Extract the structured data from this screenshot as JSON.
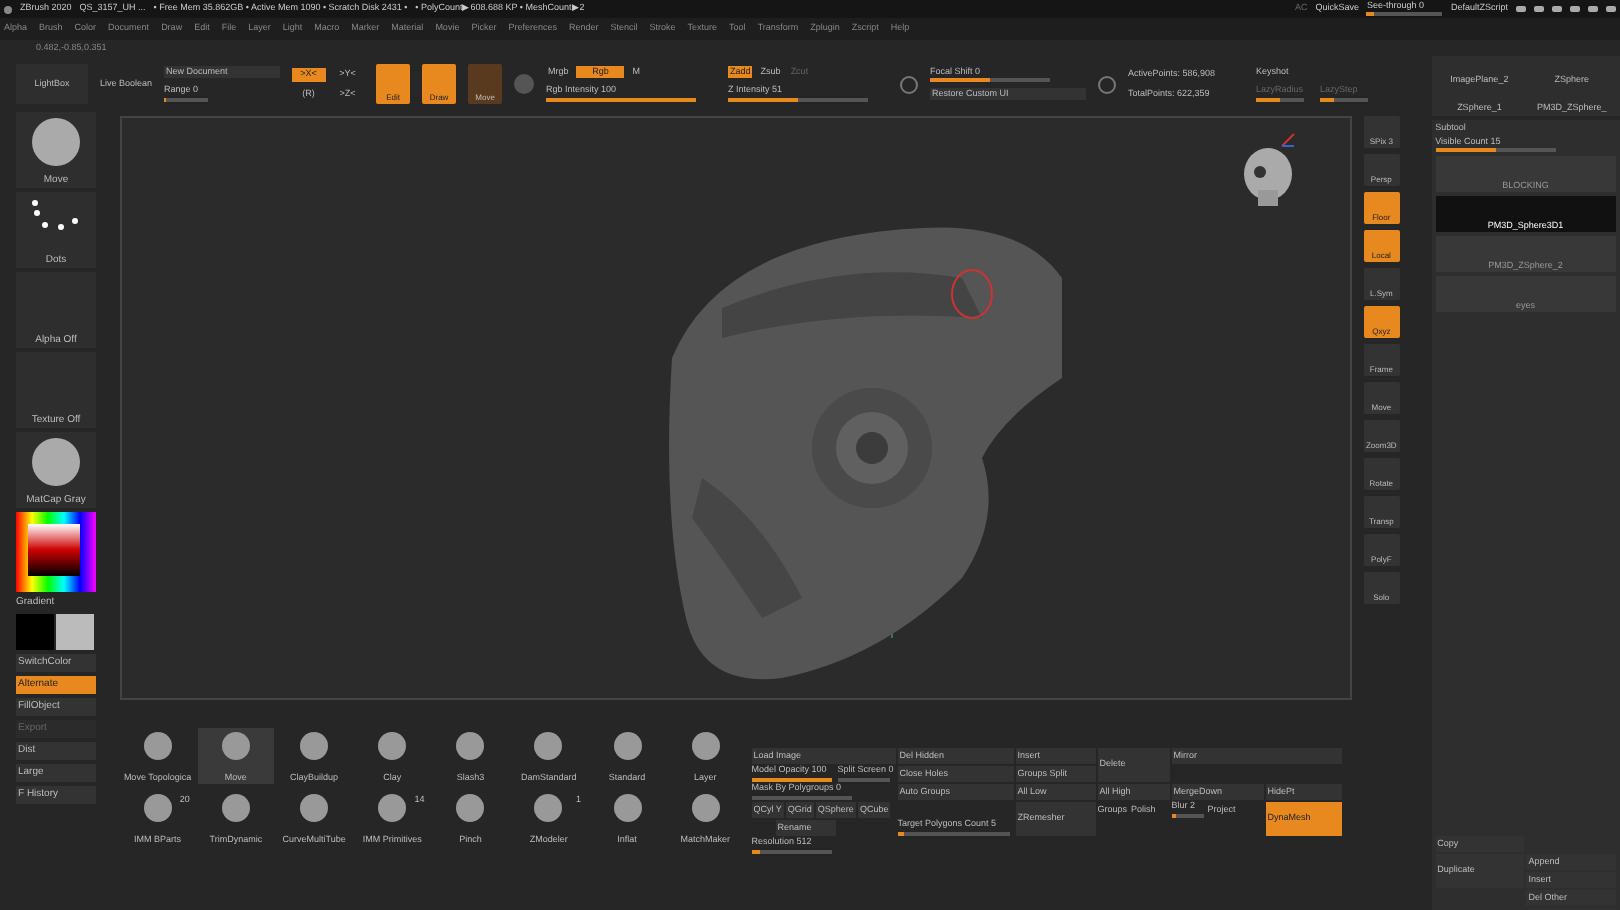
{
  "title_bar": {
    "app": "ZBrush 2020",
    "file": "QS_3157_UH ...",
    "stats": [
      "• Free Mem 35.862GB • Active Mem 1090 • Scratch Disk 2431 •",
      "• PolyCount▶608.688 KP • MeshCount▶2"
    ],
    "ac": "AC",
    "quicksave": "QuickSave",
    "see_through": {
      "label": "See-through 0",
      "level": 0.1
    },
    "script": "DefaultZScript"
  },
  "menu": [
    "Alpha",
    "Brush",
    "Color",
    "Document",
    "Draw",
    "Edit",
    "File",
    "Layer",
    "Light",
    "Macro",
    "Marker",
    "Material",
    "Movie",
    "Picker",
    "Preferences",
    "Render",
    "Stencil",
    "Stroke",
    "Texture",
    "Tool",
    "Transform",
    "Zplugin",
    "Zscript",
    "Help"
  ],
  "coords": "0.482,-0.85,0.351",
  "toolbar": {
    "lightbox": "LightBox",
    "live_boolean": "Live Boolean",
    "document": "New Document",
    "range": {
      "label": "Range 0",
      "level": 0.05
    },
    "axes": [
      {
        "label": ">X<",
        "selected": true
      },
      {
        "label": ">Y<",
        "selected": false
      },
      {
        "label": "(R)",
        "selected": false
      },
      {
        "label": ">Z<",
        "selected": false
      }
    ],
    "modes": [
      {
        "label": "Edit",
        "selected": true
      },
      {
        "label": "Draw",
        "selected": true
      },
      {
        "label": "Move",
        "selected": false
      }
    ],
    "mrgb": [
      {
        "label": "Mrgb",
        "selected": false
      },
      {
        "label": "Rgb",
        "selected": true
      },
      {
        "label": "M",
        "selected": false
      }
    ],
    "rgb_intensity": {
      "label": "Rgb Intensity 100",
      "level": 1
    },
    "zmodes": [
      {
        "label": "Zadd",
        "selected": true
      },
      {
        "label": "Zsub",
        "selected": false
      },
      {
        "label": "Zcut",
        "selected": false,
        "disabled": true
      }
    ],
    "z_intensity": {
      "label": "Z Intensity 51",
      "level": 0.5
    },
    "focal_shift": {
      "label": "Focal Shift 0",
      "level": 0.5
    },
    "restore": "Restore Custom UI",
    "active_points": "ActivePoints: 586,908",
    "total_points": "TotalPoints: 622,359",
    "keyshot": "Keyshot",
    "lazy": [
      {
        "label": "LazyRadius",
        "level": 0.5
      },
      {
        "label": "LazyStep",
        "level": 0.3
      }
    ]
  },
  "left_shelf": {
    "tiles": [
      {
        "label": "Move",
        "kind": "brush"
      },
      {
        "label": "Dots",
        "kind": "dots"
      },
      {
        "label": "Alpha Off",
        "kind": "empty"
      },
      {
        "label": "Texture Off",
        "kind": "empty"
      },
      {
        "label": "MatCap Gray",
        "kind": "sphere"
      }
    ],
    "gradient": "Gradient",
    "buttons": [
      {
        "label": "SwitchColor",
        "selected": false,
        "disabled": false
      },
      {
        "label": "Alternate",
        "selected": true,
        "disabled": false
      },
      {
        "label": "FillObject",
        "selected": false,
        "disabled": false
      },
      {
        "label": "Export",
        "selected": false,
        "disabled": true
      },
      {
        "label": "Dist",
        "selected": false,
        "disabled": false
      },
      {
        "label": "Large",
        "selected": false,
        "disabled": false
      },
      {
        "label": "F History",
        "selected": false,
        "disabled": false
      }
    ]
  },
  "right_shelf": [
    {
      "label": "SPix 3",
      "selected": false
    },
    {
      "label": "Persp",
      "selected": false
    },
    {
      "label": "Floor",
      "selected": true
    },
    {
      "label": "Local",
      "selected": true
    },
    {
      "label": "L.Sym",
      "selected": false
    },
    {
      "label": "Qxyz",
      "selected": true
    },
    {
      "label": "Frame",
      "selected": false
    },
    {
      "label": "Move",
      "selected": false
    },
    {
      "label": "Zoom3D",
      "selected": false
    },
    {
      "label": "Rotate",
      "selected": false
    },
    {
      "label": "Transp",
      "selected": false
    },
    {
      "label": "PolyF",
      "selected": false
    },
    {
      "label": "Solo",
      "selected": false
    }
  ],
  "tool_thumbs": [
    "ImagePlane_2",
    "ZSphere",
    "ZSphere_1",
    "PM3D_ZSphere_"
  ],
  "subtool": {
    "title": "Subtool",
    "visible_count": {
      "label": "Visible Count 15",
      "level": 0.5
    },
    "items": [
      {
        "name": "BLOCKING",
        "selected": false
      },
      {
        "name": "PM3D_Sphere3D1",
        "selected": true
      },
      {
        "name": "PM3D_ZSphere_2",
        "selected": false
      },
      {
        "name": "eyes",
        "selected": false
      }
    ],
    "buttons": [
      "Copy",
      "Duplicate",
      "Append",
      "Insert",
      "Del Other"
    ]
  },
  "brushes": [
    {
      "name": "Move Topologica",
      "selected": false
    },
    {
      "name": "Move",
      "selected": true
    },
    {
      "name": "ClayBuildup",
      "selected": false
    },
    {
      "name": "Clay",
      "selected": false
    },
    {
      "name": "Slash3",
      "selected": false
    },
    {
      "name": "DamStandard",
      "selected": false
    },
    {
      "name": "Standard",
      "selected": false
    },
    {
      "name": "Layer",
      "selected": false
    },
    {
      "name": "IMM BParts",
      "selected": false,
      "count": "20"
    },
    {
      "name": "TrimDynamic",
      "selected": false
    },
    {
      "name": "CurveMultiTube",
      "selected": false
    },
    {
      "name": "IMM Primitives",
      "selected": false,
      "count": "14"
    },
    {
      "name": "Pinch",
      "selected": false
    },
    {
      "name": "ZModeler",
      "selected": false,
      "count": "1"
    },
    {
      "name": "Inflat",
      "selected": false
    },
    {
      "name": "MatchMaker",
      "selected": false
    }
  ],
  "geometry": {
    "load_image": "Load Image",
    "model_opacity": {
      "label": "Model Opacity 100",
      "level": 1
    },
    "split_screen": {
      "label": "Split Screen 0",
      "level": 0
    },
    "mask_polygroups": {
      "label": "Mask By Polygroups 0",
      "level": 0
    },
    "quick": [
      "QCyl Y",
      "QGrid",
      "QSphere",
      "QCube"
    ],
    "rename": "Rename",
    "target_polygons": {
      "label": "Target Polygons Count 5",
      "level": 0.05
    },
    "col2": [
      "Del Hidden",
      "Close Holes",
      "Auto Groups"
    ],
    "col3": [
      "Insert",
      "Groups Split",
      "All Low"
    ],
    "zremesher": "ZRemesher",
    "delete": "Delete",
    "all_high": "All High",
    "groups": "Groups",
    "polish": "Polish",
    "blur": {
      "label": "Blur 2",
      "level": 0.15
    },
    "project": "Project",
    "resolution": {
      "label": "Resolution 512",
      "level": 0.1
    },
    "mirror": "Mirror",
    "merge_down": "MergeDown",
    "hidept": "HidePt",
    "dynamesh": {
      "label": "DynaMesh",
      "selected": true
    }
  }
}
